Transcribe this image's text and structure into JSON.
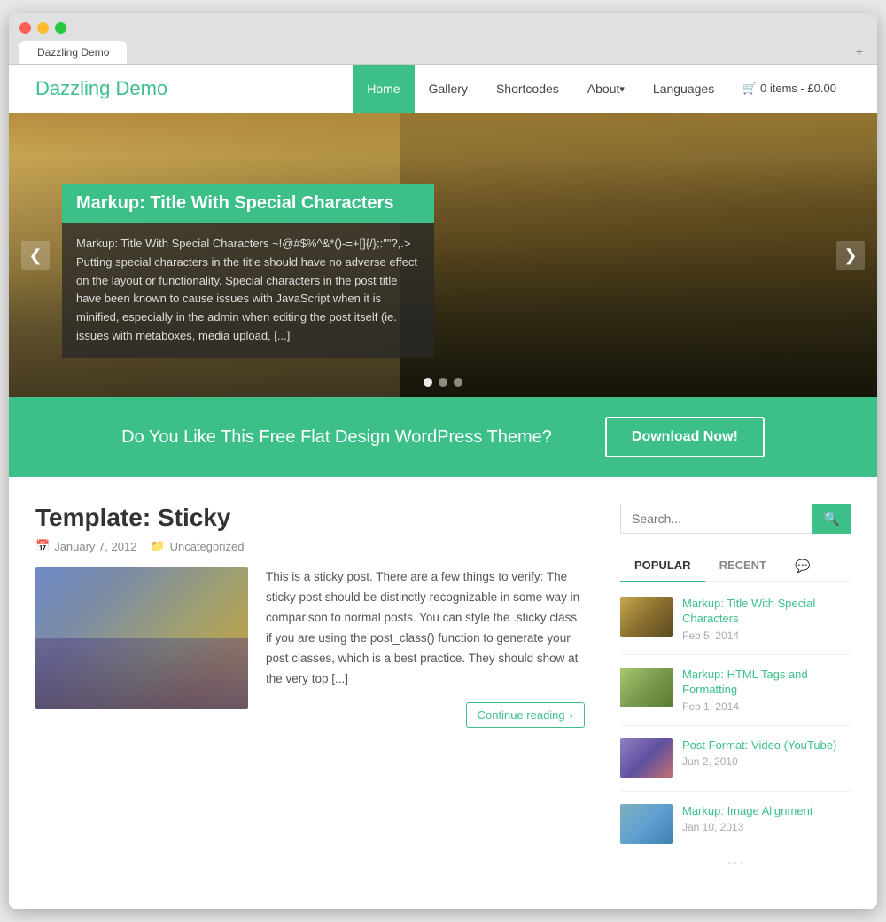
{
  "browser": {
    "tab_title": "Dazzling Demo",
    "expand_icon": "+"
  },
  "header": {
    "logo": "Dazzling Demo",
    "nav": [
      {
        "label": "Home",
        "active": true
      },
      {
        "label": "Gallery"
      },
      {
        "label": "Shortcodes"
      },
      {
        "label": "About",
        "dropdown": true
      },
      {
        "label": "Languages"
      },
      {
        "label": "🛒 0 items - £0.00"
      }
    ]
  },
  "hero": {
    "title": "Markup: Title With Special Characters",
    "text": "Markup: Title With Special Characters ~!@#$%^&*()-=+[]{/};:\"\"?,.> Putting special characters in the title should have no adverse effect on the layout or functionality. Special characters in the post title have been known to cause issues with JavaScript when it is minified, especially in the admin when editing the post itself (ie. issues with metaboxes, media upload, [...]",
    "arrow_left": "❮",
    "arrow_right": "❯",
    "dots": [
      1,
      2,
      3
    ],
    "active_dot": 0
  },
  "cta": {
    "text": "Do You Like This Free Flat Design WordPress Theme?",
    "button": "Download Now!"
  },
  "post": {
    "title": "Template: Sticky",
    "date": "January 7, 2012",
    "category": "Uncategorized",
    "excerpt": "This is a sticky post. There are a few things to verify: The sticky post should be distinctly recognizable in some way in comparison to normal posts. You can style the .sticky class if you are using the post_class() function to generate your post classes, which is a best practice. They should show at the very top [...]",
    "continue_reading": "Continue reading"
  },
  "sidebar": {
    "search_placeholder": "Search...",
    "search_icon": "🔍",
    "tabs": [
      {
        "label": "POPULAR",
        "active": true
      },
      {
        "label": "RECENT"
      },
      {
        "label": "💬",
        "icon": true
      }
    ],
    "recent_posts": [
      {
        "title": "Markup: Title With Special Characters",
        "date": "Feb 5, 2014",
        "thumb_class": "thumb-1"
      },
      {
        "title": "Markup: HTML Tags and Formatting",
        "date": "Feb 1, 2014",
        "thumb_class": "thumb-2"
      },
      {
        "title": "Post Format: Video (YouTube)",
        "date": "Jun 2, 2010",
        "thumb_class": "thumb-3"
      },
      {
        "title": "Markup: Image Alignment",
        "date": "Jan 10, 2013",
        "thumb_class": "thumb-4"
      }
    ]
  }
}
